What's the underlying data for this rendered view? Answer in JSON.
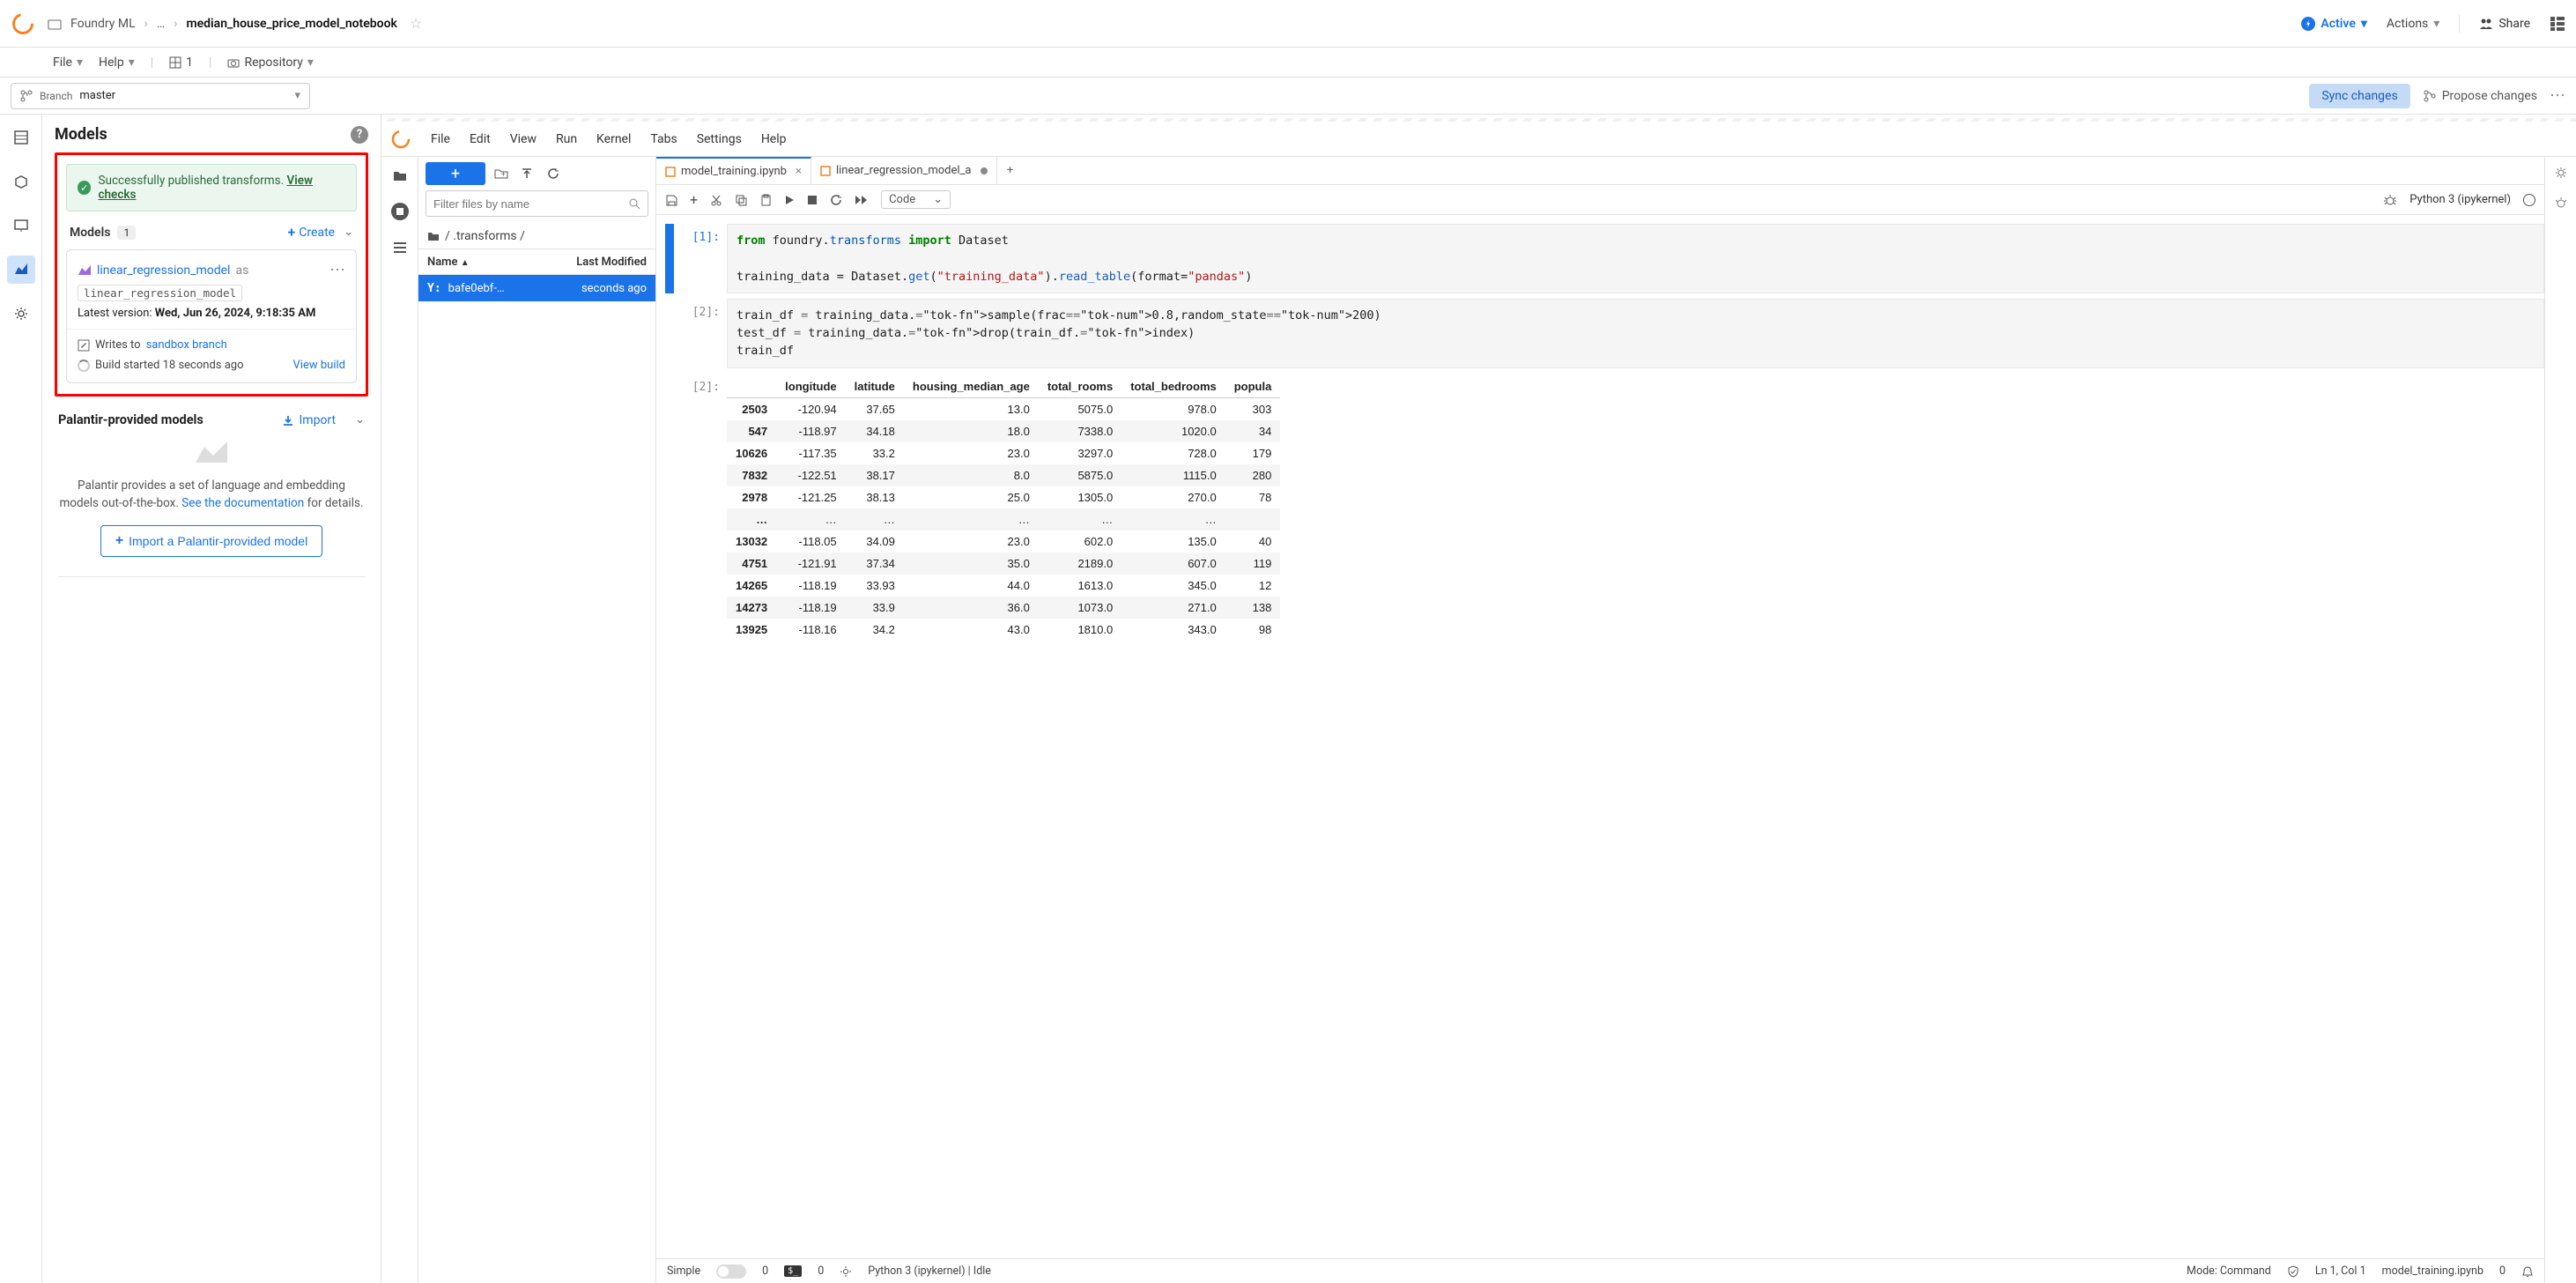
{
  "header": {
    "breadcrumb_root": "Foundry ML",
    "breadcrumb_ellipsis": "…",
    "breadcrumb_current": "median_house_price_model_notebook",
    "active_label": "Active",
    "actions_label": "Actions",
    "share_label": "Share"
  },
  "submenu": {
    "file": "File",
    "help": "Help",
    "one": "1",
    "repository": "Repository"
  },
  "branch": {
    "label": "Branch",
    "name": "master",
    "sync": "Sync changes",
    "propose": "Propose changes"
  },
  "models_panel": {
    "title": "Models",
    "success_text": "Successfully published transforms. ",
    "view_checks": "View checks",
    "models_label": "Models",
    "models_count": "1",
    "create": "Create",
    "model_name": "linear_regression_model",
    "as": "as",
    "model_code_name": "linear_regression_model",
    "latest_prefix": "Latest version: ",
    "latest_value": "Wed, Jun 26, 2024, 9:18:35 AM",
    "writes_to": "Writes to ",
    "sandbox": "sandbox branch",
    "build_text": "Build started 18 seconds ago",
    "view_build": "View build",
    "palantir_title": "Palantir-provided models",
    "import": "Import",
    "palantir_desc_1": "Palantir provides a set of language and embedding models out-of-the-box. ",
    "palantir_link": "See the documentation",
    "palantir_desc_2": " for details.",
    "import_btn": "Import a Palantir-provided model"
  },
  "jupyter": {
    "menus": [
      "File",
      "Edit",
      "View",
      "Run",
      "Kernel",
      "Tabs",
      "Settings",
      "Help"
    ],
    "filter_placeholder": "Filter files by name",
    "path": "/ .transforms /",
    "col_name": "Name",
    "col_modified": "Last Modified",
    "file_row_name": "bafe0ebf-…",
    "file_row_time": "seconds ago",
    "tabs": [
      {
        "name": "model_training.ipynb",
        "active": true,
        "closable": true
      },
      {
        "name": "linear_regression_model_a",
        "active": false,
        "closable": false
      }
    ],
    "code_dropdown": "Code",
    "kernel": "Python 3 (ipykernel)",
    "cell1_prompt": "[1]:",
    "cell1_line1_a": "from",
    "cell1_line1_b": " foundry",
    "cell1_line1_c": ".",
    "cell1_line1_d": "transforms ",
    "cell1_line1_e": "import",
    "cell1_line1_f": " Dataset",
    "cell1_line2_a": "training_data ",
    "cell1_line2_b": "=",
    "cell1_line2_c": " Dataset",
    "cell1_line2_d": ".",
    "cell1_line2_e": "get",
    "cell1_line2_f": "(",
    "cell1_line2_g": "\"training_data\"",
    "cell1_line2_h": ")",
    "cell1_line2_i": ".",
    "cell1_line2_j": "read_table",
    "cell1_line2_k": "(",
    "cell1_line2_l": "format",
    "cell1_line2_m": "=",
    "cell1_line2_n": "\"pandas\"",
    "cell1_line2_o": ")",
    "cell2_prompt": "[2]:",
    "cell2_code": "train_df = training_data.sample(frac=0.8,random_state=200)\ntest_df = training_data.drop(train_df.index)\ntrain_df",
    "cell2_out_prompt": "[2]:",
    "df_cols": [
      "",
      "longitude",
      "latitude",
      "housing_median_age",
      "total_rooms",
      "total_bedrooms",
      "popula"
    ],
    "df_rows": [
      [
        "2503",
        "-120.94",
        "37.65",
        "13.0",
        "5075.0",
        "978.0",
        "303"
      ],
      [
        "547",
        "-118.97",
        "34.18",
        "18.0",
        "7338.0",
        "1020.0",
        "34"
      ],
      [
        "10626",
        "-117.35",
        "33.2",
        "23.0",
        "3297.0",
        "728.0",
        "179"
      ],
      [
        "7832",
        "-122.51",
        "38.17",
        "8.0",
        "5875.0",
        "1115.0",
        "280"
      ],
      [
        "2978",
        "-121.25",
        "38.13",
        "25.0",
        "1305.0",
        "270.0",
        "78"
      ],
      [
        "…",
        "…",
        "…",
        "…",
        "…",
        "…",
        ""
      ],
      [
        "13032",
        "-118.05",
        "34.09",
        "23.0",
        "602.0",
        "135.0",
        "40"
      ],
      [
        "4751",
        "-121.91",
        "37.34",
        "35.0",
        "2189.0",
        "607.0",
        "119"
      ],
      [
        "14265",
        "-118.19",
        "33.93",
        "44.0",
        "1613.0",
        "345.0",
        "12"
      ],
      [
        "14273",
        "-118.19",
        "33.9",
        "36.0",
        "1073.0",
        "271.0",
        "138"
      ],
      [
        "13925",
        "-118.16",
        "34.2",
        "43.0",
        "1810.0",
        "343.0",
        "98"
      ]
    ]
  },
  "statusbar": {
    "simple": "Simple",
    "zero1": "0",
    "zero2": "0",
    "kernel_status": "Python 3 (ipykernel) | Idle",
    "mode": "Mode: Command",
    "pos": "Ln 1, Col 1",
    "filename": "model_training.ipynb",
    "zero3": "0"
  }
}
